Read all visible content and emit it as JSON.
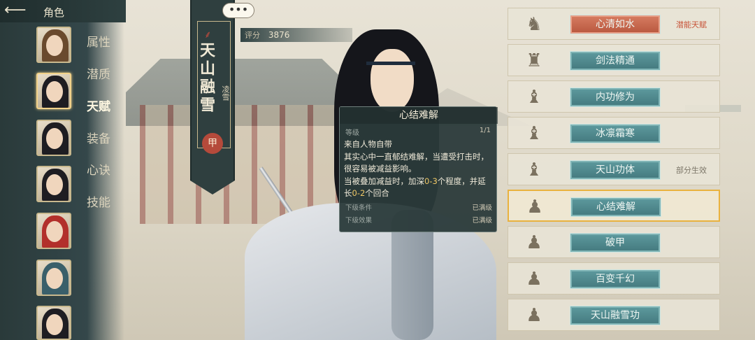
{
  "header": {
    "title": "角色",
    "back_icon": "back-arrow-icon"
  },
  "nav": {
    "items": [
      {
        "label": "属性",
        "active": false
      },
      {
        "label": "潜质",
        "active": false
      },
      {
        "label": "天赋",
        "active": true
      },
      {
        "label": "装备",
        "active": false
      },
      {
        "label": "心诀",
        "active": false
      },
      {
        "label": "技能",
        "active": false
      }
    ]
  },
  "character": {
    "name": "天山融雪",
    "sub_name": "凌雪",
    "grade": "甲",
    "score_label": "评分",
    "score_value": "3876",
    "chat_label": "•••"
  },
  "tooltip": {
    "title": "心结难解",
    "level_label": "等级",
    "level_value": "1/1",
    "desc_line1": "来自人物自带",
    "desc_line2": "其实心中一直郁结难解，当遭受打击时，很容易被减益影响。",
    "desc_line3_pre": "当被叠加减益时，加深",
    "desc_line3_hl1": "0-3",
    "desc_line3_mid": "个程度，并延长",
    "desc_line3_hl2": "0-2",
    "desc_line3_post": "个回合",
    "next_condition_label": "下级条件",
    "next_condition_value": "已满级",
    "next_effect_label": "下级效果",
    "next_effect_value": "已满级"
  },
  "talents": [
    {
      "name": "心清如水",
      "note": "潜能天赋",
      "style": "potential",
      "icon": "swordsman-pose-icon"
    },
    {
      "name": "剑法精通",
      "note": "",
      "style": "normal",
      "icon": "leaping-figure-icon"
    },
    {
      "name": "内功修为",
      "note": "",
      "style": "normal",
      "icon": "meditating-figure-icon"
    },
    {
      "name": "冰凛霜寒",
      "note": "",
      "style": "normal",
      "icon": "frost-figure-icon"
    },
    {
      "name": "天山功体",
      "note": "部分生效",
      "style": "normal",
      "icon": "body-aura-icon"
    },
    {
      "name": "心结难解",
      "note": "",
      "style": "normal",
      "icon": "standing-figure-icon",
      "selected": true
    },
    {
      "name": "破甲",
      "note": "",
      "style": "normal",
      "icon": "armor-break-icon"
    },
    {
      "name": "百变千幻",
      "note": "",
      "style": "normal",
      "icon": "illusion-figure-icon"
    },
    {
      "name": "天山融雪功",
      "note": "",
      "style": "normal",
      "icon": "snow-figure-icon"
    }
  ],
  "colors": {
    "panel": "#2f3f3f",
    "accent_teal": "#44797e",
    "accent_red": "#b8573e",
    "selected_border": "#e9b23f"
  }
}
